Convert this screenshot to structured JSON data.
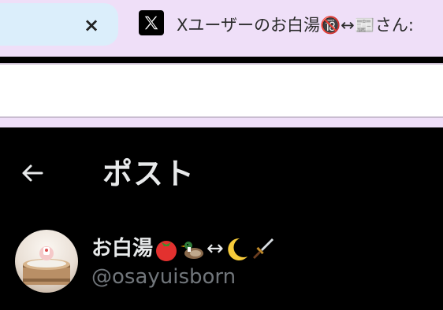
{
  "browser": {
    "active_tab": {
      "title": "Xユーザーのお白湯🔞↔📰さん:",
      "favicon": "x-logo-icon"
    },
    "inactive_tab": {
      "close_label": "×"
    }
  },
  "post": {
    "header_title": "ポスト",
    "author": {
      "display_name_text": "お白湯",
      "display_name_emoji": [
        "tomato-icon",
        "duck-icon",
        "↔",
        "crescent-moon-icon",
        "dagger-icon"
      ],
      "arrow": "↔",
      "handle": "@osayuisborn"
    }
  },
  "colors": {
    "tabstrip": "#efdff8",
    "inactive_tab": "#dbeefb",
    "background": "#000000",
    "primary_text": "#e7e9ea",
    "secondary_text": "#71767b"
  }
}
